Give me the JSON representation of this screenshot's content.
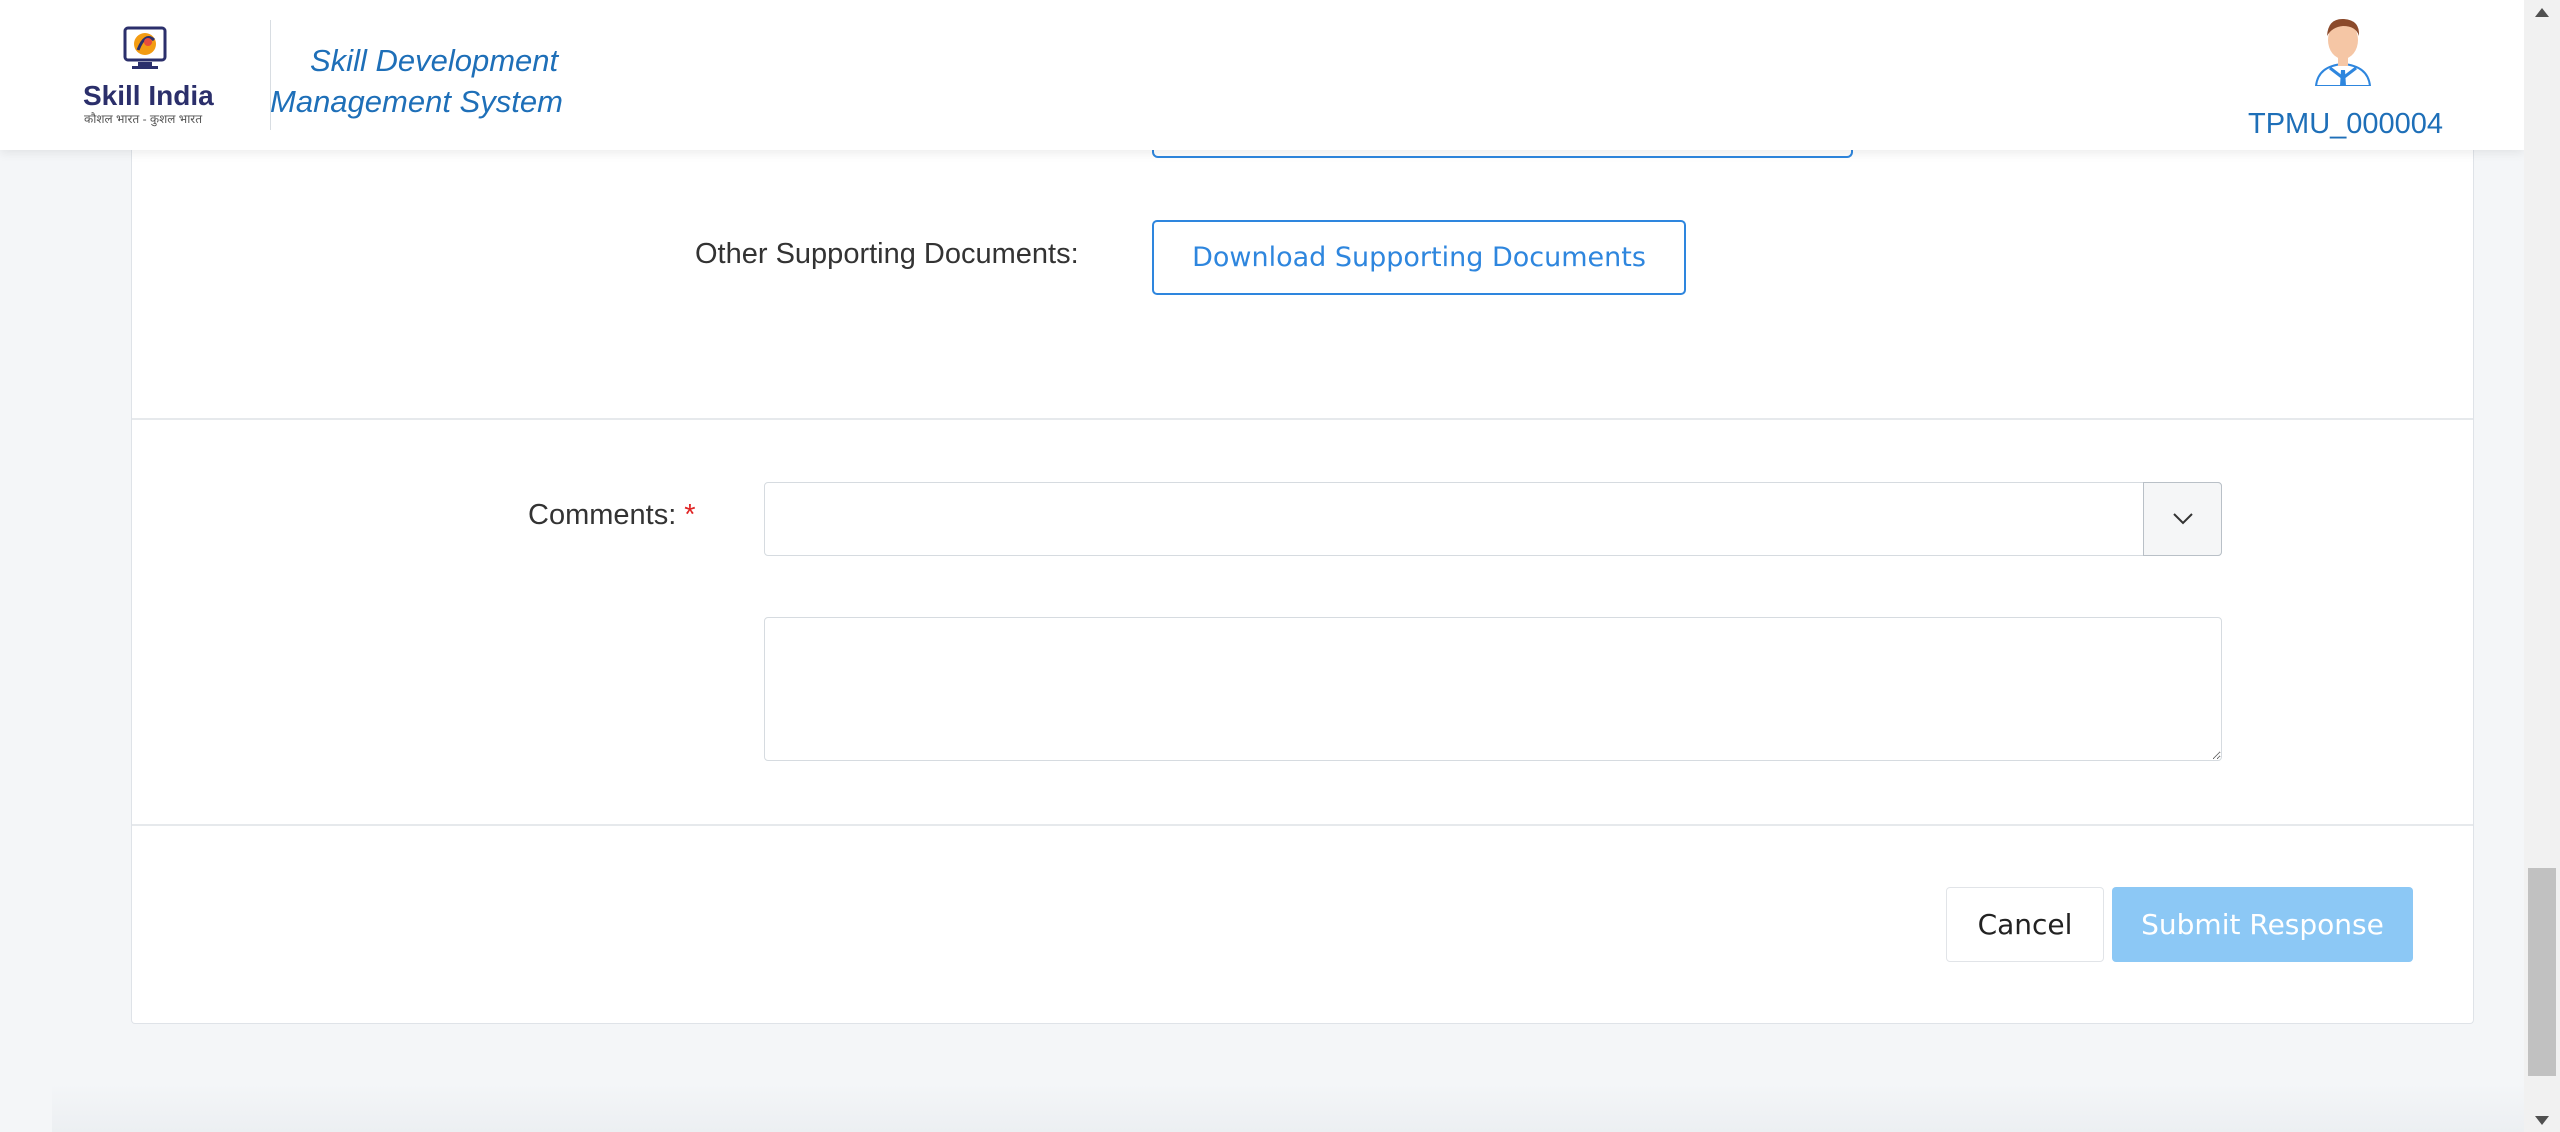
{
  "header": {
    "logo_text": "Skill India",
    "logo_subtext": "कौशल भारत - कुशल भारत",
    "app_title": "Skill Development Management System",
    "user_id": "TPMU_000004"
  },
  "form": {
    "supporting_docs_label": "Other Supporting Documents:",
    "download_button_label": "Download Supporting Documents",
    "comments_label": "Comments:",
    "required_marker": "*",
    "comments_select_value": "",
    "comments_text_value": ""
  },
  "actions": {
    "cancel_label": "Cancel",
    "submit_label": "Submit Response"
  },
  "colors": {
    "primary": "#2e86de",
    "title_blue": "#1e6fb8",
    "submit_disabled": "#8cc8f5",
    "required": "#e02424"
  },
  "icons": {
    "select_toggle": "chevron-down-icon",
    "scroll_up": "triangle-up-icon",
    "scroll_down": "triangle-down-icon"
  }
}
